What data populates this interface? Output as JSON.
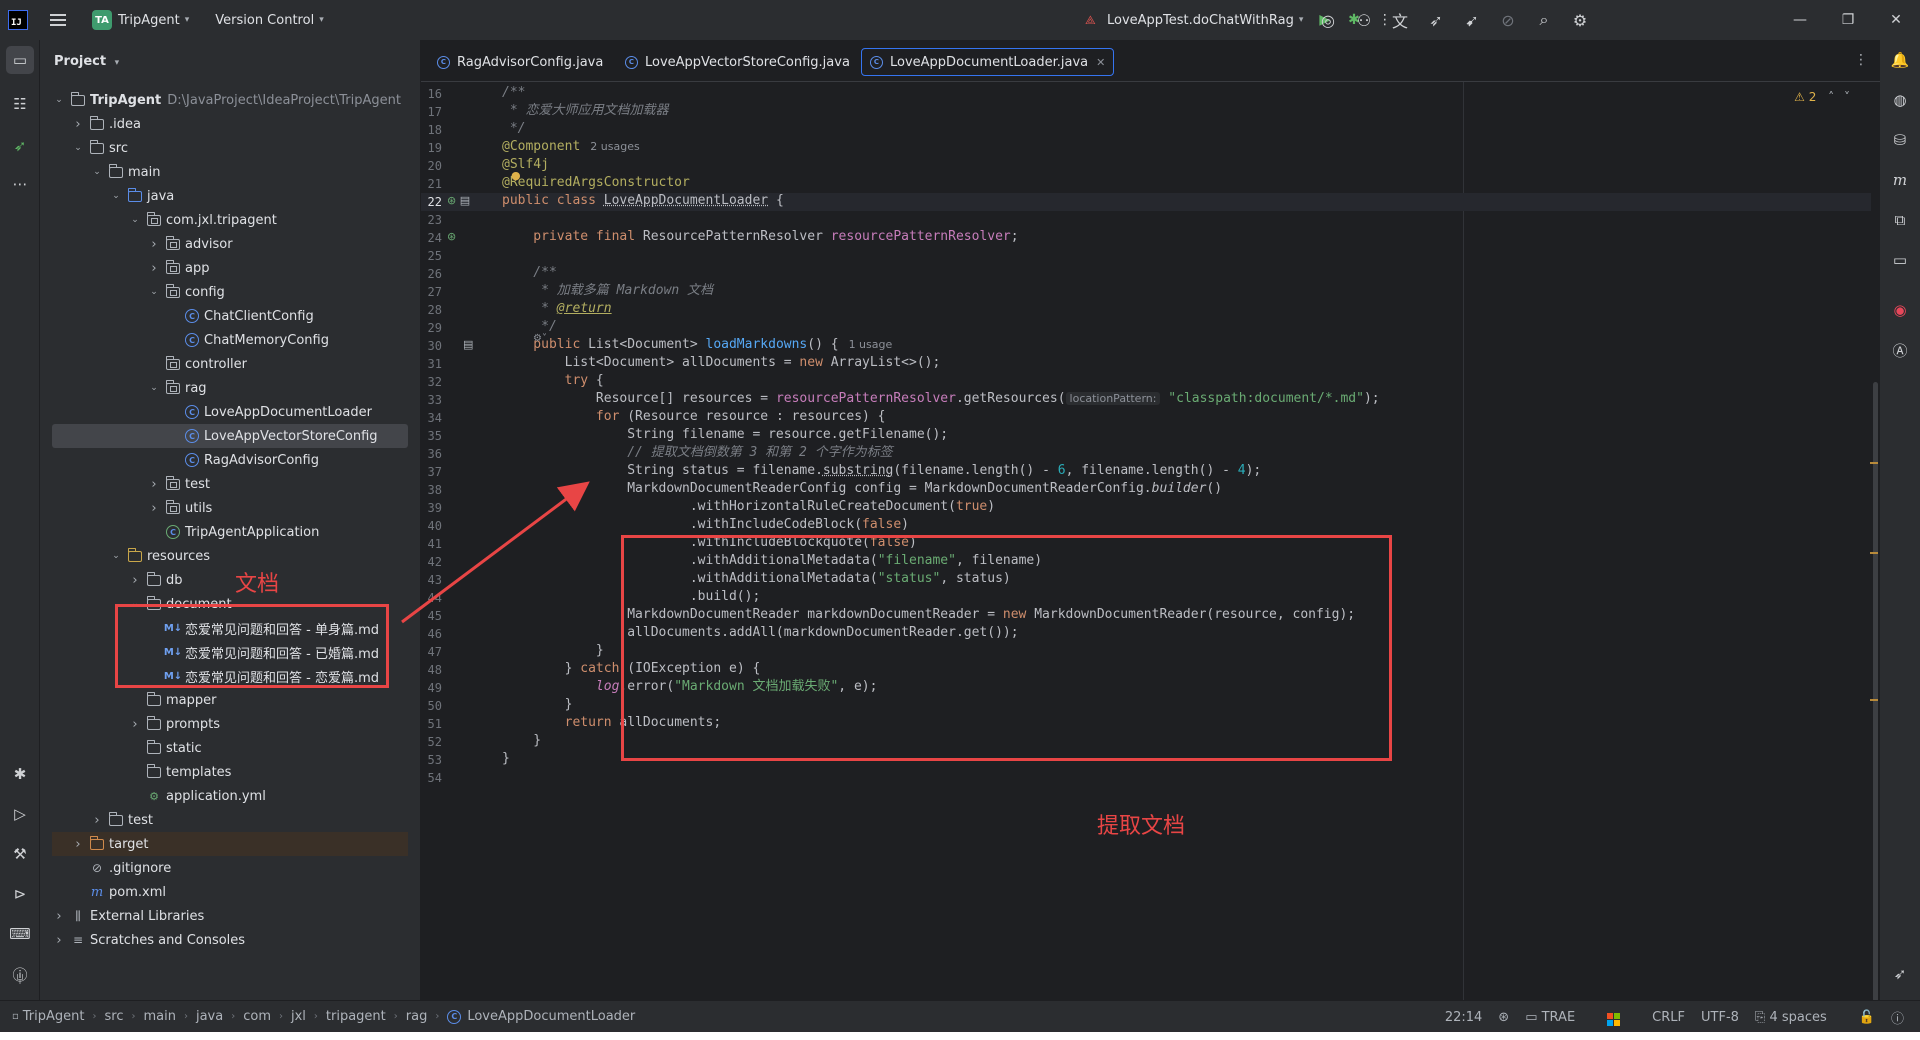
{
  "titlebar": {
    "project_badge": "TA",
    "project_name": "TripAgent",
    "vcs_label": "Version Control",
    "run_config": "LoveAppTest.doChatWithRag"
  },
  "project_panel": {
    "title": "Project",
    "tree": [
      {
        "label": "TripAgent",
        "path": "D:\\JavaProject\\IdeaProject\\TripAgent",
        "depth": 0,
        "arrow": "down",
        "icon": "module-folder"
      },
      {
        "label": ".idea",
        "depth": 1,
        "arrow": "right",
        "icon": "folder"
      },
      {
        "label": "src",
        "depth": 1,
        "arrow": "down",
        "icon": "folder"
      },
      {
        "label": "main",
        "depth": 2,
        "arrow": "down",
        "icon": "folder"
      },
      {
        "label": "java",
        "depth": 3,
        "arrow": "down",
        "icon": "src-folder"
      },
      {
        "label": "com.jxl.tripagent",
        "depth": 4,
        "arrow": "down",
        "icon": "package"
      },
      {
        "label": "advisor",
        "depth": 5,
        "arrow": "right",
        "icon": "package"
      },
      {
        "label": "app",
        "depth": 5,
        "arrow": "right",
        "icon": "package"
      },
      {
        "label": "config",
        "depth": 5,
        "arrow": "down",
        "icon": "package"
      },
      {
        "label": "ChatClientConfig",
        "depth": 6,
        "arrow": "",
        "icon": "class"
      },
      {
        "label": "ChatMemoryConfig",
        "depth": 6,
        "arrow": "",
        "icon": "class"
      },
      {
        "label": "controller",
        "depth": 5,
        "arrow": "",
        "icon": "package"
      },
      {
        "label": "rag",
        "depth": 5,
        "arrow": "down",
        "icon": "package"
      },
      {
        "label": "LoveAppDocumentLoader",
        "depth": 6,
        "arrow": "",
        "icon": "class"
      },
      {
        "label": "LoveAppVectorStoreConfig",
        "depth": 6,
        "arrow": "",
        "icon": "class",
        "selected": true
      },
      {
        "label": "RagAdvisorConfig",
        "depth": 6,
        "arrow": "",
        "icon": "class"
      },
      {
        "label": "test",
        "depth": 5,
        "arrow": "right",
        "icon": "package"
      },
      {
        "label": "utils",
        "depth": 5,
        "arrow": "right",
        "icon": "package"
      },
      {
        "label": "TripAgentApplication",
        "depth": 5,
        "arrow": "",
        "icon": "spring-class"
      },
      {
        "label": "resources",
        "depth": 3,
        "arrow": "down",
        "icon": "res-folder"
      },
      {
        "label": "db",
        "depth": 4,
        "arrow": "right",
        "icon": "folder"
      },
      {
        "label": "document",
        "depth": 4,
        "arrow": "down",
        "icon": "folder"
      },
      {
        "label": "恋爱常见问题和回答 - 单身篇.md",
        "depth": 5,
        "arrow": "",
        "icon": "markdown"
      },
      {
        "label": "恋爱常见问题和回答 - 已婚篇.md",
        "depth": 5,
        "arrow": "",
        "icon": "markdown"
      },
      {
        "label": "恋爱常见问题和回答 - 恋爱篇.md",
        "depth": 5,
        "arrow": "",
        "icon": "markdown"
      },
      {
        "label": "mapper",
        "depth": 4,
        "arrow": "",
        "icon": "folder"
      },
      {
        "label": "prompts",
        "depth": 4,
        "arrow": "right",
        "icon": "folder"
      },
      {
        "label": "static",
        "depth": 4,
        "arrow": "",
        "icon": "folder"
      },
      {
        "label": "templates",
        "depth": 4,
        "arrow": "",
        "icon": "folder"
      },
      {
        "label": "application.yml",
        "depth": 4,
        "arrow": "",
        "icon": "yaml"
      },
      {
        "label": "test",
        "depth": 2,
        "arrow": "right",
        "icon": "folder"
      },
      {
        "label": "target",
        "depth": 1,
        "arrow": "right",
        "icon": "target-folder",
        "highlight": true
      },
      {
        "label": ".gitignore",
        "depth": 1,
        "arrow": "",
        "icon": "gitignore"
      },
      {
        "label": "pom.xml",
        "depth": 1,
        "arrow": "",
        "icon": "maven"
      },
      {
        "label": "External Libraries",
        "depth": 0,
        "arrow": "right",
        "icon": "library"
      },
      {
        "label": "Scratches and Consoles",
        "depth": 0,
        "arrow": "right",
        "icon": "scratches"
      }
    ]
  },
  "editor": {
    "tabs": [
      {
        "label": "RagAdvisorConfig.java",
        "active": false
      },
      {
        "label": "LoveAppVectorStoreConfig.java",
        "active": false
      },
      {
        "label": "LoveAppDocumentLoader.java",
        "active": true
      }
    ],
    "warnings_count": "2",
    "current_line": 22,
    "line_numbers": [
      "16",
      "17",
      "18",
      "19",
      "20",
      "21",
      "22",
      "23",
      "24",
      "25",
      "26",
      "27",
      "28",
      "29",
      "30",
      "31",
      "32",
      "33",
      "34",
      "35",
      "36",
      "37",
      "38",
      "39",
      "40",
      "41",
      "42",
      "43",
      "44",
      "45",
      "46",
      "47",
      "48",
      "49",
      "50",
      "51",
      "52",
      "53",
      "54"
    ],
    "hints": {
      "component_usages": "2 usages",
      "method_usages": "1 usage",
      "param_hint": "locationPattern:"
    },
    "code": {
      "l16": "/**",
      "l17": " * 恋爱大师应用文档加载器",
      "l18": " */",
      "l19": "@Component",
      "l20": "@Slf4j",
      "l21": "@RequiredArgsConstructor",
      "l22a": "public class ",
      "l22b": "LoveAppDocumentLoader",
      "l22c": " {",
      "l24a": "    private final ",
      "l24b": "ResourcePatternResolver ",
      "l24c": "resourcePatternResolver",
      "l24d": ";",
      "l26": "    /**",
      "l27": "     * 加载多篇 Markdown 文档",
      "l28a": "     * ",
      "l28b": "@return",
      "l29": "     */",
      "l30a": "    public ",
      "l30b": "List<Document> ",
      "l30c": "loadMarkdowns",
      "l30d": "() {",
      "l31a": "        List<Document> allDocuments = ",
      "l31b": "new ",
      "l31c": "ArrayList<>();",
      "l32a": "        try",
      "l32b": " {",
      "l33a": "            Resource[] resources = ",
      "l33b": "resourcePatternResolver",
      "l33c": ".getResources(",
      "l33d": "\"classpath:document/*.md\"",
      "l33e": ");",
      "l34a": "            for",
      "l34b": " (Resource resource : resources) {",
      "l35": "                String filename = resource.getFilename();",
      "l36": "                // 提取文档倒数第 3 和第 2 个字作为标签",
      "l37a": "                String status = filename.",
      "l37b": "substring",
      "l37c": "(filename.length() - ",
      "l37d": "6",
      "l37e": ", filename.length() - ",
      "l37f": "4",
      "l37g": ");",
      "l38a": "                MarkdownDocumentReaderConfig config = MarkdownDocumentReaderConfig.",
      "l38b": "builder",
      "l38c": "()",
      "l39a": "                        .withHorizontalRuleCreateDocument(",
      "l39b": "true",
      "l39c": ")",
      "l40a": "                        .withIncludeCodeBlock(",
      "l40b": "false",
      "l40c": ")",
      "l41a": "                        .withIncludeBlockquote(",
      "l41b": "false",
      "l41c": ")",
      "l42a": "                        .withAdditionalMetadata(",
      "l42b": "\"filename\"",
      "l42c": ", filename)",
      "l43a": "                        .withAdditionalMetadata(",
      "l43b": "\"status\"",
      "l43c": ", status)",
      "l44": "                        .build();",
      "l45a": "                MarkdownDocumentReader markdownDocumentReader = ",
      "l45b": "new ",
      "l45c": "MarkdownDocumentReader(resource, config);",
      "l46": "                allDocuments.addAll(markdownDocumentReader.get());",
      "l47": "            }",
      "l48a": "        } ",
      "l48b": "catch",
      "l48c": " (IOException e) {",
      "l49a": "            ",
      "l49b": "log",
      "l49c": ".error(",
      "l49d": "\"Markdown 文档加载失败\"",
      "l49e": ", e);",
      "l50": "        }",
      "l51a": "        return",
      "l51b": " allDocuments;",
      "l52": "    }",
      "l53": "}"
    }
  },
  "annotations": {
    "doc_label": "文档",
    "extract_label": "提取文档",
    "color": "#e84545"
  },
  "statusbar": {
    "breadcrumb": [
      "TripAgent",
      "src",
      "main",
      "java",
      "com",
      "jxl",
      "tripagent",
      "rag",
      "LoveAppDocumentLoader"
    ],
    "position": "22:14",
    "plugin": "TRAE",
    "line_sep": "CRLF",
    "encoding": "UTF-8",
    "indent": "4 spaces"
  }
}
